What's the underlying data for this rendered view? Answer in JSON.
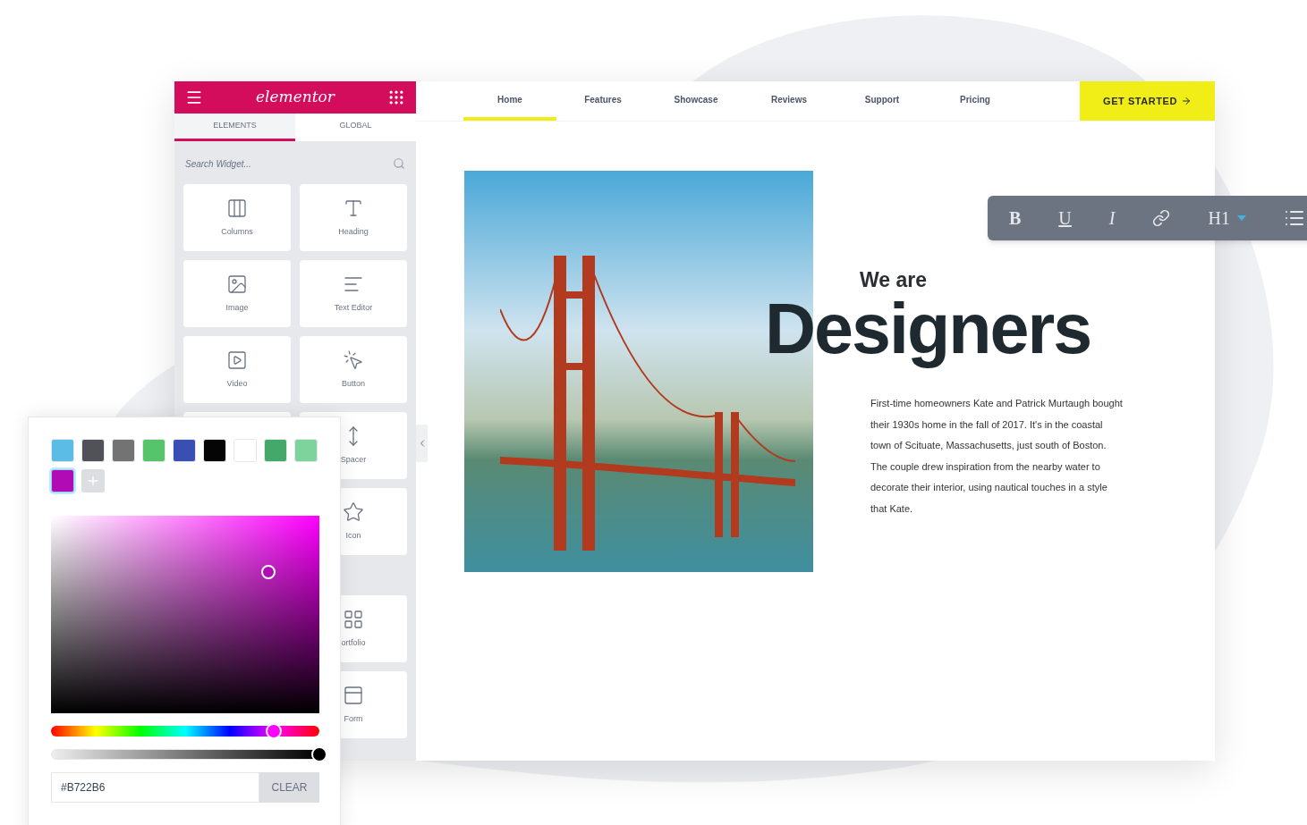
{
  "sidebar": {
    "logo": "elementor",
    "tabs": [
      {
        "label": "ELEMENTS",
        "selected": true
      },
      {
        "label": "GLOBAL",
        "selected": false
      }
    ],
    "search": {
      "placeholder": "Search Widget..."
    },
    "widgets": [
      {
        "label": "Columns"
      },
      {
        "label": "Heading"
      },
      {
        "label": "Image"
      },
      {
        "label": "Text Editor"
      },
      {
        "label": "Video"
      },
      {
        "label": "Button"
      }
    ],
    "more_widgets": [
      {
        "label": "Spacer"
      },
      {
        "label": "Icon"
      },
      {
        "label": "ortfolio"
      },
      {
        "label": "Form"
      }
    ]
  },
  "nav": {
    "items": [
      {
        "label": "Home",
        "selected": true
      },
      {
        "label": "Features",
        "selected": false
      },
      {
        "label": "Showcase",
        "selected": false
      },
      {
        "label": "Reviews",
        "selected": false
      },
      {
        "label": "Support",
        "selected": false
      },
      {
        "label": "Pricing",
        "selected": false
      }
    ],
    "cta": "GET STARTED"
  },
  "hero": {
    "kicker": "We are",
    "heading": "Designers",
    "body": "First-time homeowners Kate and Patrick Murtaugh bought their 1930s home in the fall of 2017. It's in the coastal town of Scituate, Massachusetts, just south of Boston. The couple drew inspiration from the nearby water to decorate their interior, using nautical touches in a style that Kate."
  },
  "text_toolbar": {
    "buttons": [
      {
        "kind": "bold",
        "label": "B"
      },
      {
        "kind": "underline",
        "label": "U"
      },
      {
        "kind": "italic",
        "label": "I"
      },
      {
        "kind": "link"
      },
      {
        "kind": "heading",
        "label": "H1"
      },
      {
        "kind": "list"
      }
    ]
  },
  "color_picker": {
    "swatches": [
      {
        "color": "#5bbde6",
        "selected": false
      },
      {
        "color": "#505257",
        "selected": false
      },
      {
        "color": "#737373",
        "selected": false
      },
      {
        "color": "#55c46b",
        "selected": false
      },
      {
        "color": "#3a4fb3",
        "selected": false
      },
      {
        "color": "#050505",
        "selected": false
      },
      {
        "color": "#ffffff",
        "selected": false
      },
      {
        "color": "#43a86a",
        "selected": false
      },
      {
        "color": "#7ed39c",
        "selected": false
      },
      {
        "color": "#b10bb6",
        "selected": true
      }
    ],
    "hue": {
      "level": 0.83
    },
    "alpha": {
      "level": 1
    },
    "value": "#B722B6",
    "clear": "CLEAR"
  }
}
